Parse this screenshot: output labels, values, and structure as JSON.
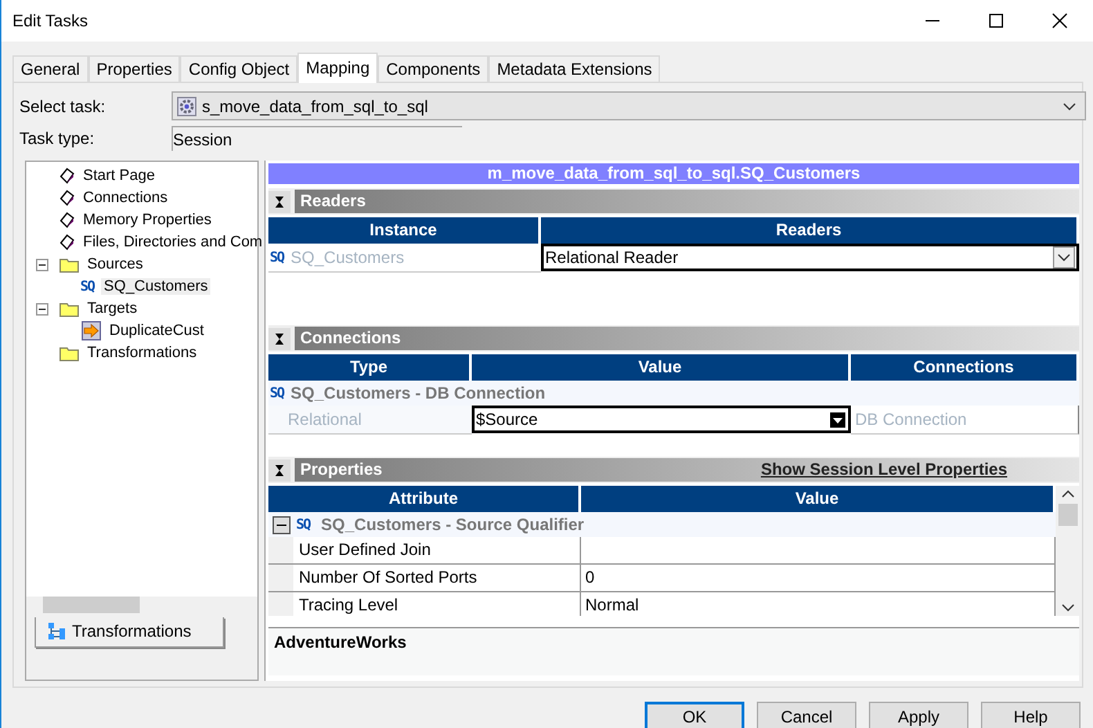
{
  "window": {
    "title": "Edit Tasks"
  },
  "tabs": [
    {
      "label": "General",
      "selected": false
    },
    {
      "label": "Properties",
      "selected": false
    },
    {
      "label": "Config Object",
      "selected": false
    },
    {
      "label": "Mapping",
      "selected": true
    },
    {
      "label": "Components",
      "selected": false
    },
    {
      "label": "Metadata Extensions",
      "selected": false
    }
  ],
  "select_task": {
    "label": "Select task:",
    "value": "s_move_data_from_sql_to_sql"
  },
  "task_type": {
    "label": "Task type:",
    "value": "Session"
  },
  "tree": [
    {
      "label": "Start Page",
      "kind": "page",
      "selected": false
    },
    {
      "label": "Connections",
      "kind": "page",
      "selected": false
    },
    {
      "label": "Memory Properties",
      "kind": "page",
      "selected": false
    },
    {
      "label": "Files, Directories and Com",
      "kind": "page",
      "selected": false
    },
    {
      "label": "Sources",
      "kind": "folder",
      "selected": false,
      "expanded": true,
      "children": [
        {
          "label": "SQ_Customers",
          "kind": "source",
          "icon_text": "SQ",
          "selected": true
        }
      ]
    },
    {
      "label": "Targets",
      "kind": "folder",
      "selected": false,
      "expanded": true,
      "children": [
        {
          "label": "DuplicateCust",
          "kind": "target",
          "selected": false
        }
      ]
    },
    {
      "label": "Transformations",
      "kind": "folder",
      "selected": false
    }
  ],
  "bottom_tab": {
    "label": "Transformations"
  },
  "mapping_title": "m_move_data_from_sql_to_sql.SQ_Customers",
  "readers": {
    "title": "Readers",
    "columns": [
      "Instance",
      "Readers"
    ],
    "rows": [
      {
        "icon_text": "SQ",
        "instance": "SQ_Customers",
        "reader": "Relational Reader"
      }
    ]
  },
  "connections": {
    "title": "Connections",
    "columns": [
      "Type",
      "Value",
      "Connections"
    ],
    "group": {
      "icon_text": "SQ",
      "label": "SQ_Customers - DB Connection"
    },
    "rows": [
      {
        "type": "Relational",
        "value": "$Source",
        "connection": "DB Connection"
      }
    ]
  },
  "properties": {
    "title": "Properties",
    "link": "Show Session Level Properties",
    "columns": [
      "Attribute",
      "Value"
    ],
    "group": {
      "icon_text": "SQ",
      "label": "SQ_Customers - Source Qualifier",
      "expanded": true
    },
    "rows": [
      {
        "attribute": "User Defined Join",
        "value": ""
      },
      {
        "attribute": "Number Of Sorted Ports",
        "value": "0"
      },
      {
        "attribute": "Tracing Level",
        "value": "Normal"
      }
    ]
  },
  "description": "AdventureWorks",
  "buttons": [
    {
      "label": "OK",
      "default": true
    },
    {
      "label": "Cancel",
      "default": false
    },
    {
      "label": "Apply",
      "default": false
    },
    {
      "label": "Help",
      "default": false
    }
  ]
}
